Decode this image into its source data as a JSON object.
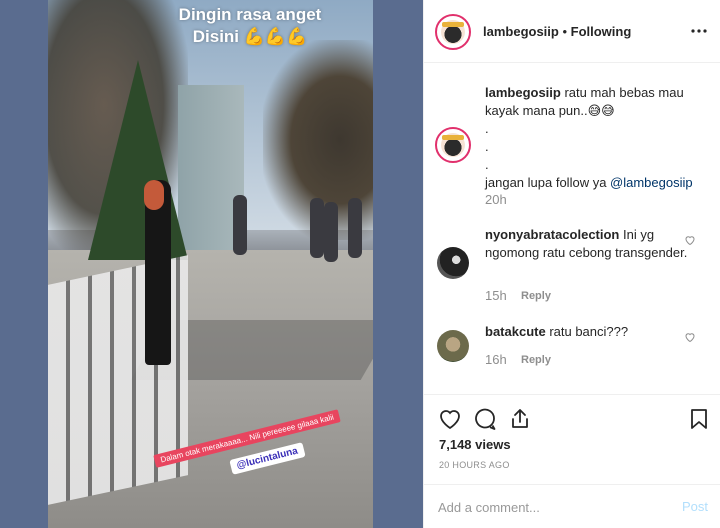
{
  "story": {
    "overlay_line1": "Dingin rasa anget",
    "overlay_line2": "Disini 💪💪💪",
    "sticker_text": "Dalam otak merakaaaa... Nili pereeeee gilaaa kalii",
    "sticker_mention": "@lucintaluna"
  },
  "header": {
    "username": "lambegosiip",
    "separator": " • ",
    "follow_status": "Following",
    "more_icon": "more-dots-icon"
  },
  "caption": {
    "username": "lambegosiip",
    "text": " ratu mah bebas mau kayak mana pun..😅😅",
    "dot1": ".",
    "dot2": ".",
    "dot3": ".",
    "follow_line": "jangan lupa follow ya ",
    "mention": "@lambegosiip",
    "time": "20h"
  },
  "comments": [
    {
      "username": "nyonyabratacolection",
      "text": " Ini yg ngomong ratu cebong transgender.",
      "time": "15h",
      "reply": "Reply"
    },
    {
      "username": "batakcute",
      "text": " ratu banci???",
      "time": "16h",
      "reply": "Reply"
    }
  ],
  "actions": {
    "views": "7,148 views",
    "posted_ago": "20 HOURS AGO",
    "icons": [
      "heart-icon",
      "comment-icon",
      "share-icon",
      "bookmark-icon"
    ]
  },
  "add_comment": {
    "placeholder": "Add a comment...",
    "post_label": "Post"
  },
  "colors": {
    "accent": "#3897f0",
    "post_disabled": "#b2dffc",
    "muted": "#8e8e8e",
    "sticker_pink": "#e8455f"
  }
}
